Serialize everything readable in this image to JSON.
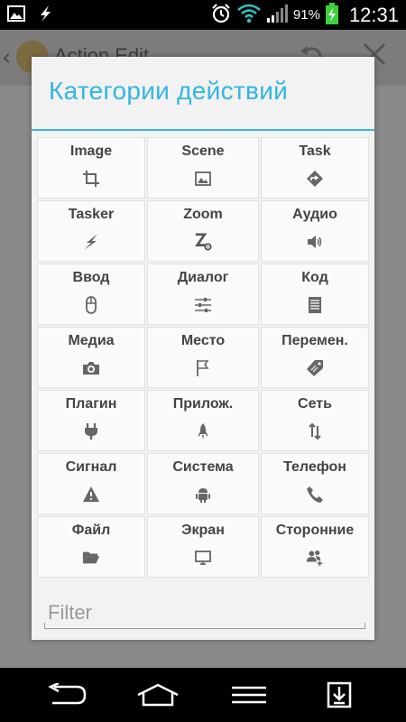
{
  "status_bar": {
    "battery_percent": "91%",
    "time": "12:31",
    "icons": [
      "image-notification-icon",
      "flash-notification-icon",
      "alarm-icon",
      "wifi-icon",
      "signal-icon",
      "battery-charging-icon"
    ]
  },
  "app_bar": {
    "title": "Action Edit",
    "icons": [
      "back-arrow-icon",
      "tasker-logo-icon",
      "undo-icon",
      "close-icon"
    ]
  },
  "dialog": {
    "title": "Категории действий",
    "accent_color": "#33b5e5",
    "categories": [
      {
        "label": "Image",
        "icon": "crop-icon"
      },
      {
        "label": "Scene",
        "icon": "picture-icon"
      },
      {
        "label": "Task",
        "icon": "diamond-arrow-icon"
      },
      {
        "label": "Tasker",
        "icon": "lightning-icon"
      },
      {
        "label": "Zoom",
        "icon": "zoom-z-gear-icon"
      },
      {
        "label": "Аудио",
        "icon": "speaker-icon"
      },
      {
        "label": "Ввод",
        "icon": "mouse-icon"
      },
      {
        "label": "Диалог",
        "icon": "sliders-icon"
      },
      {
        "label": "Код",
        "icon": "document-icon"
      },
      {
        "label": "Медиа",
        "icon": "camera-icon"
      },
      {
        "label": "Место",
        "icon": "flag-icon"
      },
      {
        "label": "Перемен.",
        "icon": "tag-icon"
      },
      {
        "label": "Плагин",
        "icon": "plug-icon"
      },
      {
        "label": "Прилож.",
        "icon": "rocket-icon"
      },
      {
        "label": "Сеть",
        "icon": "up-down-arrows-icon"
      },
      {
        "label": "Сигнал",
        "icon": "warning-icon"
      },
      {
        "label": "Система",
        "icon": "android-icon"
      },
      {
        "label": "Телефон",
        "icon": "phone-icon"
      },
      {
        "label": "Файл",
        "icon": "folder-icon"
      },
      {
        "label": "Экран",
        "icon": "monitor-icon"
      },
      {
        "label": "Сторонние",
        "icon": "add-people-icon"
      }
    ],
    "filter_placeholder": "Filter"
  },
  "nav_bar": {
    "icons": [
      "back-nav-icon",
      "home-nav-icon",
      "menu-nav-icon",
      "download-nav-icon"
    ]
  }
}
